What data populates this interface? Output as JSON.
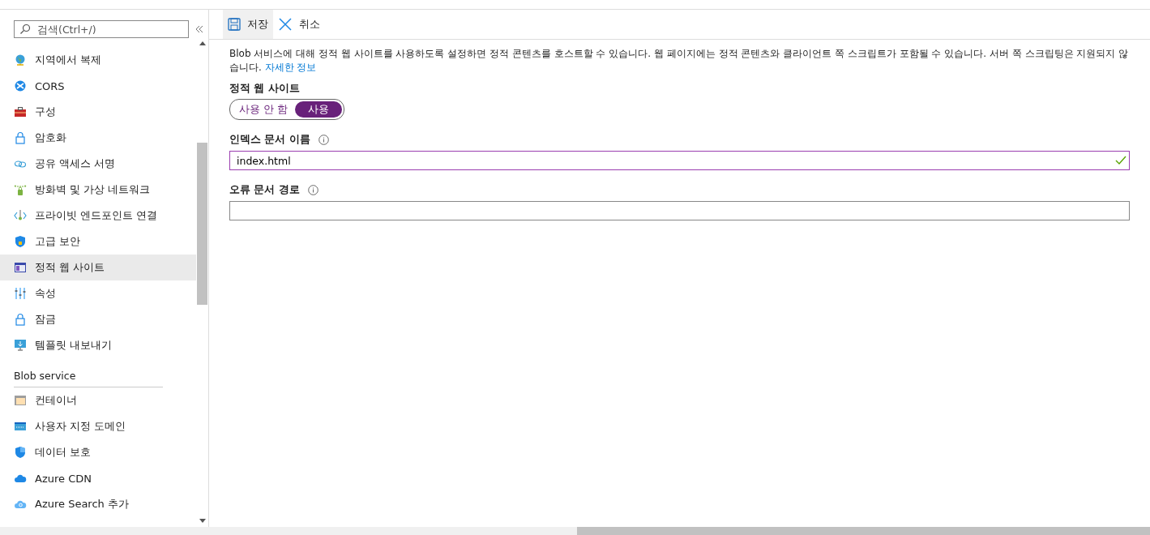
{
  "sidebar": {
    "search": {
      "placeholder": "검색(Ctrl+/)"
    },
    "groups": [
      {
        "items": [
          {
            "label": "지역에서 복제",
            "selected": false
          },
          {
            "label": "CORS",
            "selected": false
          },
          {
            "label": "구성",
            "selected": false
          },
          {
            "label": "암호화",
            "selected": false
          },
          {
            "label": "공유 액세스 서명",
            "selected": false
          },
          {
            "label": "방화벽 및 가상 네트워크",
            "selected": false
          },
          {
            "label": "프라이빗 엔드포인트 연결",
            "selected": false
          },
          {
            "label": "고급 보안",
            "selected": false
          },
          {
            "label": "정적 웹 사이트",
            "selected": true
          },
          {
            "label": "속성",
            "selected": false
          },
          {
            "label": "잠금",
            "selected": false
          },
          {
            "label": "템플릿 내보내기",
            "selected": false
          }
        ]
      },
      {
        "heading": "Blob service",
        "items": [
          {
            "label": "컨테이너",
            "selected": false
          },
          {
            "label": "사용자 지정 도메인",
            "selected": false
          },
          {
            "label": "데이터 보호",
            "selected": false
          },
          {
            "label": "Azure CDN",
            "selected": false
          },
          {
            "label": "Azure Search 추가",
            "selected": false
          }
        ]
      }
    ]
  },
  "toolbar": [
    {
      "kind": "save",
      "label": "저장",
      "hovered": true
    },
    {
      "kind": "cancel",
      "label": "취소",
      "hovered": false
    }
  ],
  "description": {
    "text": "Blob 서비스에 대해 정적 웹 사이트를 사용하도록 설정하면 정적 콘텐츠를 호스트할 수 있습니다. 웹 페이지에는 정적 콘텐츠와 클라이언트 쪽 스크립트가 포함될 수 있습니다. 서버 쪽 스크립팅은 지원되지 않습니다.",
    "link": "자세한 정보"
  },
  "static_website": {
    "label": "정적 웹 사이트",
    "options": [
      {
        "label": "사용 안 함",
        "selected": false
      },
      {
        "label": "사용",
        "selected": true
      }
    ]
  },
  "fields": [
    {
      "label": "인덱스 문서 이름",
      "value": "index.html",
      "valid": true
    },
    {
      "label": "오류 문서 경로",
      "valid": false
    }
  ]
}
